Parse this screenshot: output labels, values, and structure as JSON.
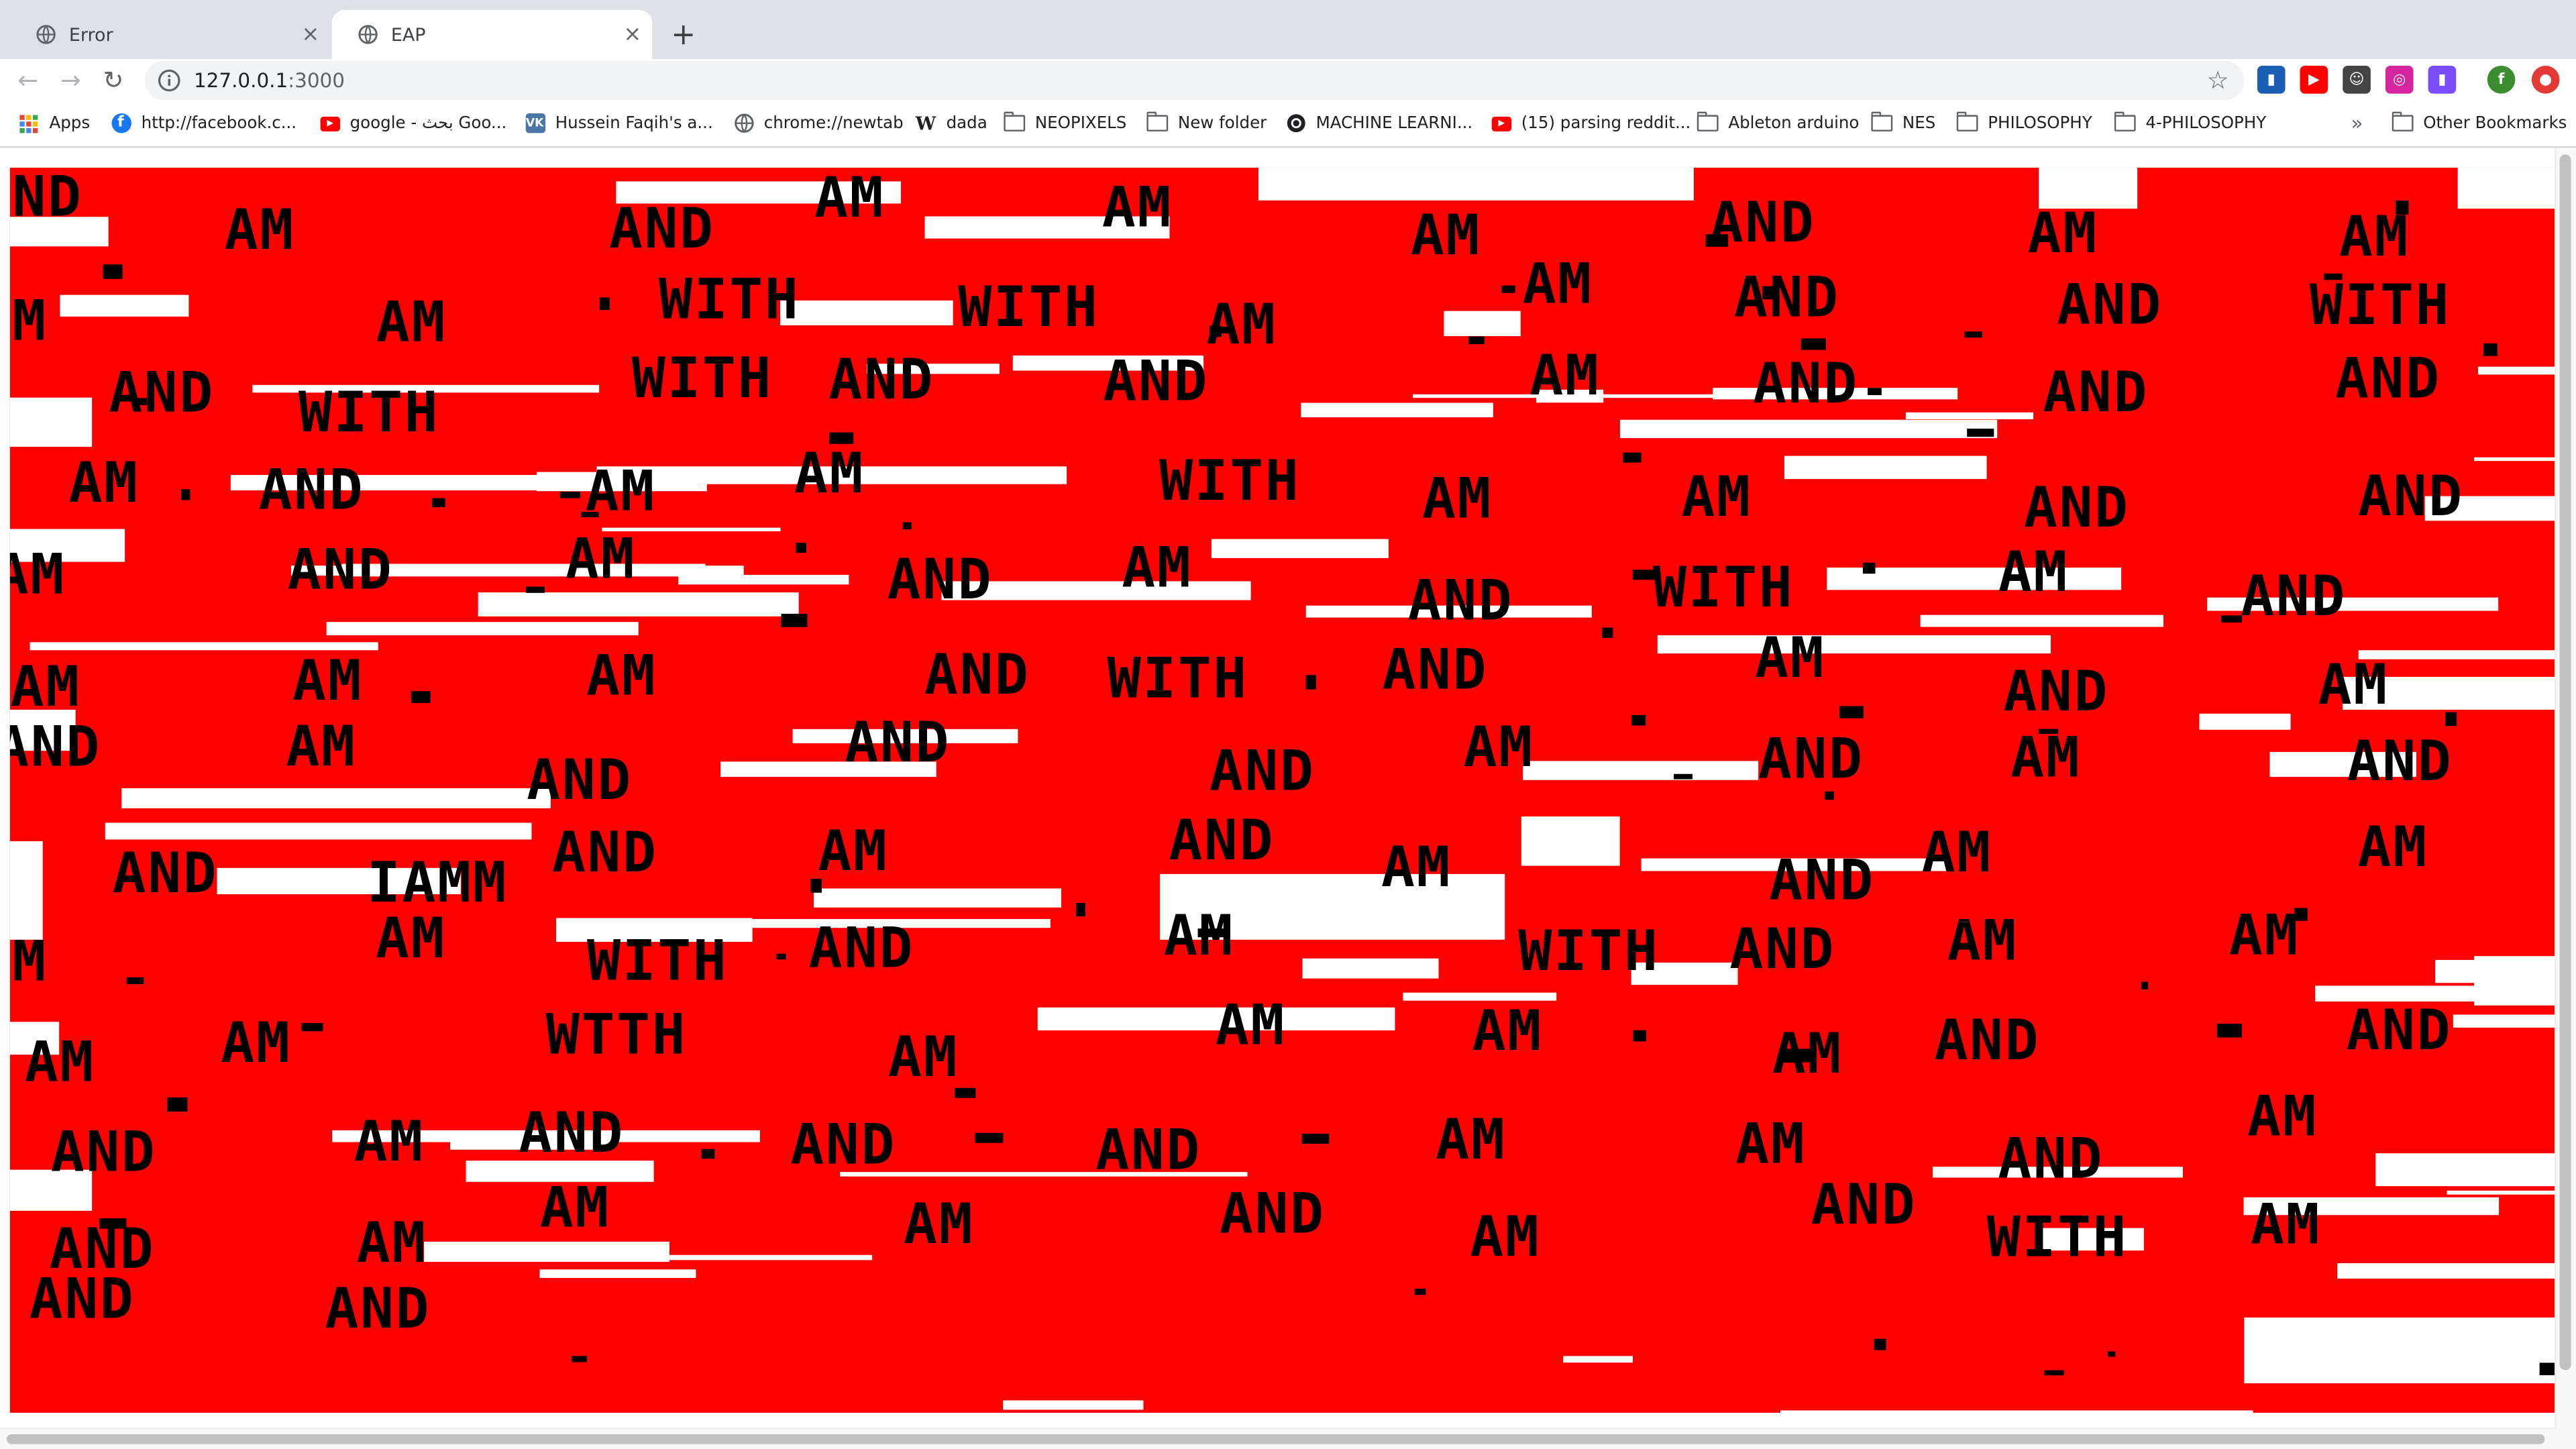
{
  "tabs": [
    {
      "title": "Error",
      "close": "×"
    },
    {
      "title": "EAP",
      "close": "×"
    }
  ],
  "new_tab_label": "+",
  "nav": {
    "back": "←",
    "forward": "→",
    "reload": "↻"
  },
  "address": {
    "host": "127.0.0.1",
    "port": ":3000"
  },
  "bookmark_star": "☆",
  "extensions": [
    {
      "name": "chart-extension-icon",
      "color": "#1a5fb4",
      "glyph": "▮"
    },
    {
      "name": "youtube-extension-icon",
      "color": "#ff0000",
      "glyph": "▶"
    },
    {
      "name": "face-extension-icon",
      "color": "#444444",
      "glyph": "☺"
    },
    {
      "name": "instagram-extension-icon",
      "color": "#d6249f",
      "glyph": "◎"
    },
    {
      "name": "gradient-extension-icon",
      "color": "#7b4dff",
      "glyph": "▮"
    },
    {
      "name": "profile-avatar-icon",
      "color": "#3c8d2f",
      "glyph": "f"
    },
    {
      "name": "red-extension-icon",
      "color": "#e53935",
      "glyph": "●"
    }
  ],
  "bookmarks": [
    {
      "label": "Apps",
      "icon": "apps-grid-icon"
    },
    {
      "label": "http://facebook.c...",
      "icon": "facebook-icon"
    },
    {
      "label": "google - بحث Goo...",
      "icon": "youtube-icon"
    },
    {
      "label": "Hussein Faqih's a...",
      "icon": "vk-icon"
    },
    {
      "label": "chrome://newtab",
      "icon": "globe-icon"
    },
    {
      "label": "dada",
      "icon": "wikipedia-icon"
    },
    {
      "label": "NEOPIXELS",
      "icon": "folder-icon"
    },
    {
      "label": "New folder",
      "icon": "folder-icon"
    },
    {
      "label": "MACHINE LEARNI...",
      "icon": "ml-icon"
    },
    {
      "label": "(15) parsing reddit...",
      "icon": "youtube-icon"
    },
    {
      "label": "Ableton arduino",
      "icon": "folder-icon"
    },
    {
      "label": "NES",
      "icon": "folder-icon"
    },
    {
      "label": "PHILOSOPHY",
      "icon": "folder-icon"
    },
    {
      "label": "4-PHILOSOPHY",
      "icon": "folder-icon"
    }
  ],
  "bookmarks_overflow": "»",
  "other_bookmarks": "Other Bookmarks",
  "canvas": {
    "background": "#ff0000",
    "text_color": "#000000",
    "words": [
      "AND",
      "AM",
      "AND",
      "AM",
      "AM",
      "AM",
      "AND",
      "AM",
      "AM",
      "AM",
      "AM",
      "WITH",
      "WITH",
      "AM",
      "AM",
      "AND",
      "AND",
      "WITH",
      "AND",
      "WITH",
      "WITH",
      "AND",
      "AND",
      "AM",
      "AND",
      "AND",
      "AND",
      "AM",
      "AND",
      "AM",
      "AM",
      "WITH",
      "AM",
      "AM",
      "AND",
      "AND",
      "AM",
      "AND",
      "AM",
      "AND",
      "AM",
      "AND",
      "WITH",
      "AM",
      "AND",
      "AM",
      "AM",
      "AM",
      "AND",
      "WITH",
      "AND",
      "AM",
      "AND",
      "AM",
      "AND",
      "AM",
      "AND",
      "AND",
      "AND",
      "AM",
      "AND",
      "AM",
      "AND",
      "AND",
      "IAMM",
      "AND",
      "AM",
      "AND",
      "AM",
      "AND",
      "AM",
      "AM",
      "AM",
      "AM",
      "WITH",
      "AND",
      "AM",
      "WITH",
      "AND",
      "AM",
      "AM",
      "AM",
      "AM",
      "WTTH",
      "AM",
      "AM",
      "AM",
      "AM",
      "AND",
      "AND",
      "AND",
      "AM",
      "AND",
      "AND",
      "AND",
      "AM",
      "AM",
      "AND",
      "AM",
      "AND",
      "AM",
      "AM",
      "AM",
      "AND",
      "AM",
      "AND",
      "WITH",
      "AM",
      "AND",
      "AND"
    ]
  }
}
